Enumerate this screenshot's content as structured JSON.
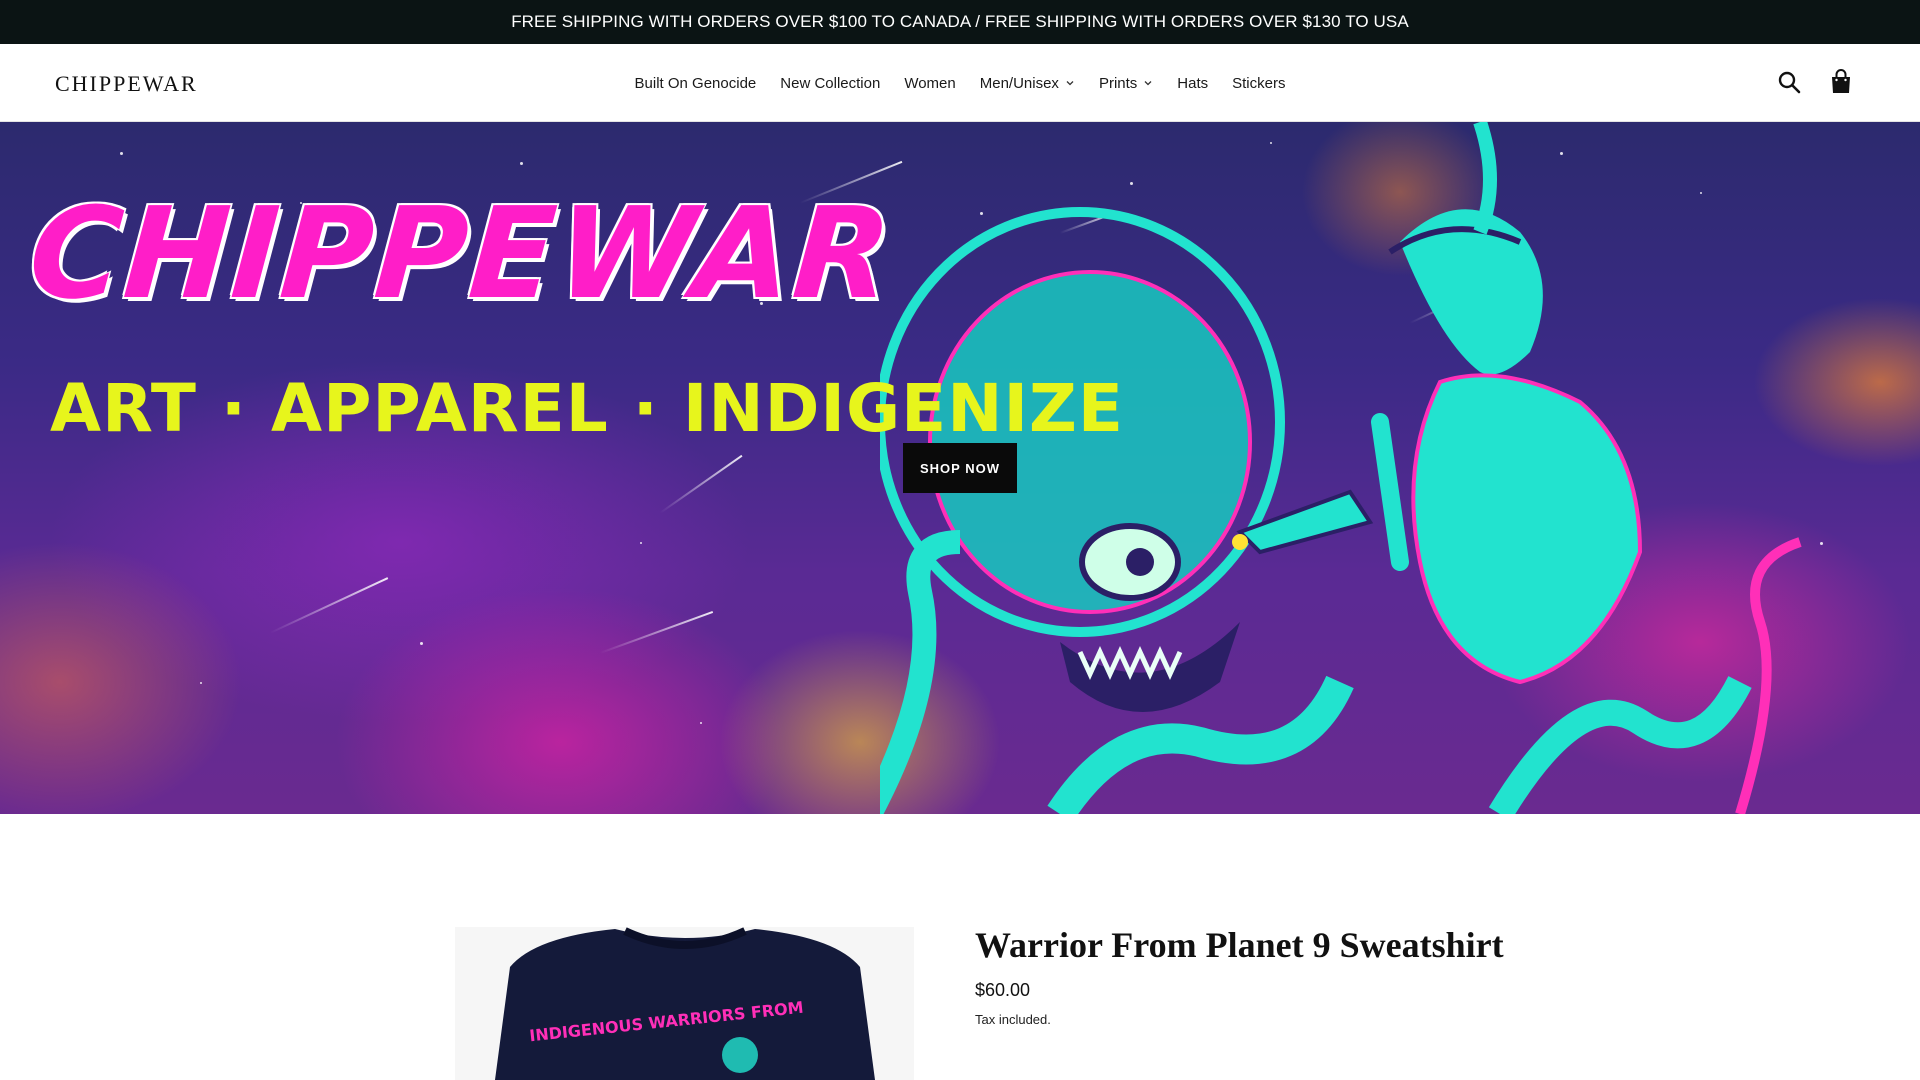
{
  "announcement": {
    "text": "FREE SHIPPING WITH ORDERS OVER $100 TO CANADA / FREE SHIPPING WITH ORDERS OVER $130 TO USA"
  },
  "header": {
    "logo": "CHIPPEWAR",
    "nav": [
      {
        "label": "Built On Genocide",
        "has_dropdown": false
      },
      {
        "label": "New Collection",
        "has_dropdown": false
      },
      {
        "label": "Women",
        "has_dropdown": false
      },
      {
        "label": "Men/Unisex",
        "has_dropdown": true
      },
      {
        "label": "Prints",
        "has_dropdown": true
      },
      {
        "label": "Hats",
        "has_dropdown": false
      },
      {
        "label": "Stickers",
        "has_dropdown": false
      }
    ],
    "icons": [
      "search-icon",
      "cart-icon"
    ]
  },
  "hero": {
    "title": "CHIPPEWAR",
    "subtitle": "ART · APPAREL · INDIGENIZE",
    "button_label": "SHOP NOW",
    "colors": {
      "title": "#ff1ec8",
      "subtitle": "#e7f51c",
      "art": "#22e3cf"
    }
  },
  "product": {
    "title": "Warrior From Planet 9 Sweatshirt",
    "price": "$60.00",
    "tax_note": "Tax included.",
    "shirt_print_text": "INDIGENOUS WARRIORS FROM"
  }
}
